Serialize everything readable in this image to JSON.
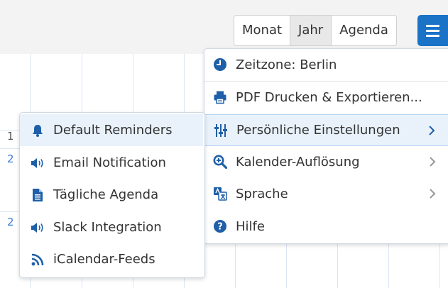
{
  "views": {
    "month": "Monat",
    "year": "Jahr",
    "agenda": "Agenda"
  },
  "background_days": [
    "1",
    "2",
    "2"
  ],
  "main_menu": {
    "timezone": "Zeitzone: Berlin",
    "pdf": "PDF Drucken & Exportieren...",
    "personal_settings": "Persönliche Einstellungen",
    "resolution": "Kalender-Auflösung",
    "language": "Sprache",
    "help": "Hilfe"
  },
  "sub_menu": {
    "default_reminders": "Default Reminders",
    "email_notification": "Email Notification",
    "daily_agenda": "Tägliche Agenda",
    "slack": "Slack Integration",
    "ical": "iCalendar-Feeds"
  },
  "colors": {
    "accent": "#1a73c7",
    "highlight": "#e9f2fb",
    "icon": "#1f5fa8",
    "link": "#3b7dd8"
  },
  "icons": [
    "clock-icon",
    "printer-icon",
    "sliders-icon",
    "zoom-in-icon",
    "translate-icon",
    "help-icon",
    "bell-icon",
    "speaker-icon",
    "document-icon",
    "rss-icon",
    "chevron-right-icon",
    "hamburger-icon"
  ]
}
